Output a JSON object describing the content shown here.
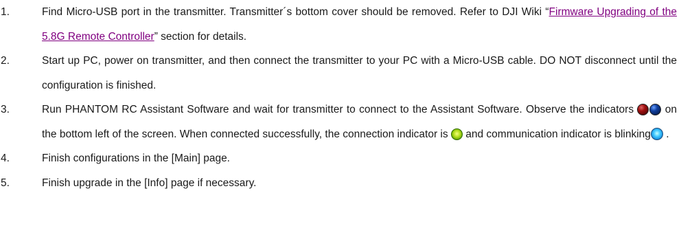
{
  "steps": [
    {
      "number": "1.",
      "text_a": "Find Micro-USB port in the transmitter. Transmitter´s bottom cover should be removed. Refer to DJI Wiki “",
      "link": "Firmware Upgrading of the 5.8G Remote Controller",
      "text_b": "” section for details."
    },
    {
      "number": "2.",
      "text": "Start up PC, power on transmitter, and then connect the transmitter to your PC with a Micro-USB cable. DO NOT disconnect until the configuration is finished."
    },
    {
      "number": "3.",
      "text_a": "Run PHANTOM RC Assistant Software and wait for transmitter to connect to the Assistant Software. Observe the indicators ",
      "text_b": " on the bottom left of the screen. When connected successfully, the connection indicator is ",
      "text_c": " and communication indicator is blinking",
      "text_d": " ."
    },
    {
      "number": "4.",
      "text": "Finish configurations in the [Main] page."
    },
    {
      "number": "5.",
      "text": "Finish upgrade in the [Info] page if necessary."
    }
  ],
  "icons": {
    "indicator_pair": [
      "red-led-icon",
      "blue-led-icon"
    ],
    "connected_indicator": "green-led-icon",
    "blinking_indicator": "cyan-led-icon"
  },
  "colors": {
    "link": "#800080",
    "text": "#1a1a1a"
  }
}
